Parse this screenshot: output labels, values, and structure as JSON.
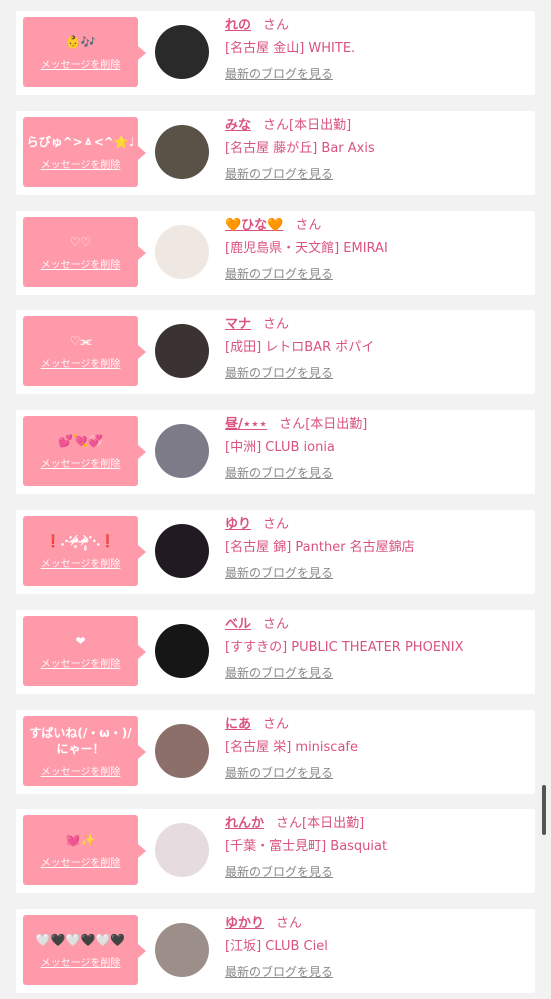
{
  "common": {
    "delete_label": "メッセージを削除",
    "blog_label": "最新のブログを見る",
    "san_label": "さん"
  },
  "items": [
    {
      "message": "👶🎶",
      "name": "れの",
      "status": "",
      "shop": "[名古屋 金山] WHITE.",
      "avatar": "#2a2a2a"
    },
    {
      "message": "らぴゅ^>ㅿ<^⭐️♩",
      "name": "みな",
      "status": "[本日出勤]",
      "shop": "[名古屋 藤が丘] Bar Axis",
      "avatar": "#5a5246"
    },
    {
      "message": "♡♡",
      "name": "🧡ひな🧡",
      "status": "",
      "shop": "[鹿児島県・天文館] EMIRAI",
      "avatar": "#efe7e2"
    },
    {
      "message": "♡⫘",
      "name": "マナ",
      "status": "",
      "shop": "[成田] レトロBAR ポパイ",
      "avatar": "#3b3331"
    },
    {
      "message": "💕💘💞",
      "name": "昼/⋆⋆⋆",
      "status": "[本日出勤]",
      "shop": "[中洲] CLUB ionia",
      "avatar": "#7d7b88"
    },
    {
      "message": "❗️⋰ᵒ̴̶̷̥́ ᵒ̴̶̷̣̥̀⋱❗️",
      "name": "ゆり",
      "status": "",
      "shop": "[名古屋 錦] Panther 名古屋錦店",
      "avatar": "#221a22"
    },
    {
      "message": "❤",
      "name": "ベル",
      "status": "",
      "shop": "[すすきの] PUBLIC THEATER PHOENIX",
      "avatar": "#161616"
    },
    {
      "message": "すばいね(/・ω・)/\nにゃー！",
      "name": "にあ",
      "status": "",
      "shop": "[名古屋 栄] miniscafe",
      "avatar": "#8b6f68"
    },
    {
      "message": "💓✨",
      "name": "れんか",
      "status": "[本日出勤]",
      "shop": "[千葉・富士見町] Basquiat",
      "avatar": "#e6dce0"
    },
    {
      "message": "🤍🖤🤍🖤🤍🖤",
      "name": "ゆかり",
      "status": "",
      "shop": "[江坂] CLUB Ciel",
      "avatar": "#9c8f8a"
    }
  ]
}
